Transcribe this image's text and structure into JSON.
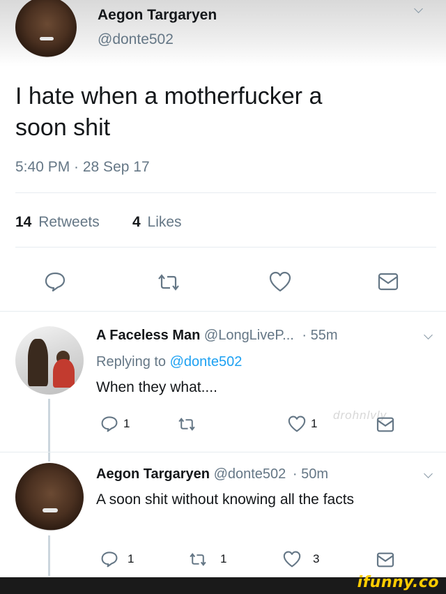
{
  "tweet": {
    "author_name": "Aegon Targaryen",
    "author_handle": "@donte502",
    "text_line1": "I hate when a motherfucker a",
    "text_line2": "soon shit",
    "timestamp": "5:40 PM · 28 Sep 17",
    "retweets_count": "14",
    "retweets_label": "Retweets",
    "likes_count": "4",
    "likes_label": "Likes"
  },
  "reply1": {
    "author_name": "A Faceless Man",
    "author_handle": "@LongLiveP...",
    "time": "· 55m",
    "replying_prefix": "Replying to",
    "replying_handle": "@donte502",
    "text": "When they what....",
    "reply_count": "1",
    "like_count": "1",
    "watermark": "drohnlvly"
  },
  "reply2": {
    "author_name": "Aegon Targaryen",
    "author_handle": "@donte502",
    "time": "· 50m",
    "text": "A soon shit without knowing all the facts",
    "reply_count": "1",
    "retweet_count": "1",
    "like_count": "3"
  },
  "branding": {
    "ifunny": "ifunny.co"
  },
  "icons": [
    "reply-icon",
    "retweet-icon",
    "like-icon",
    "message-icon",
    "chevron-down-icon"
  ],
  "colors": {
    "text": "#14171a",
    "secondary": "#657786",
    "link": "#1da1f2",
    "icon": "#657786",
    "ifunny": "#ffcc00"
  }
}
